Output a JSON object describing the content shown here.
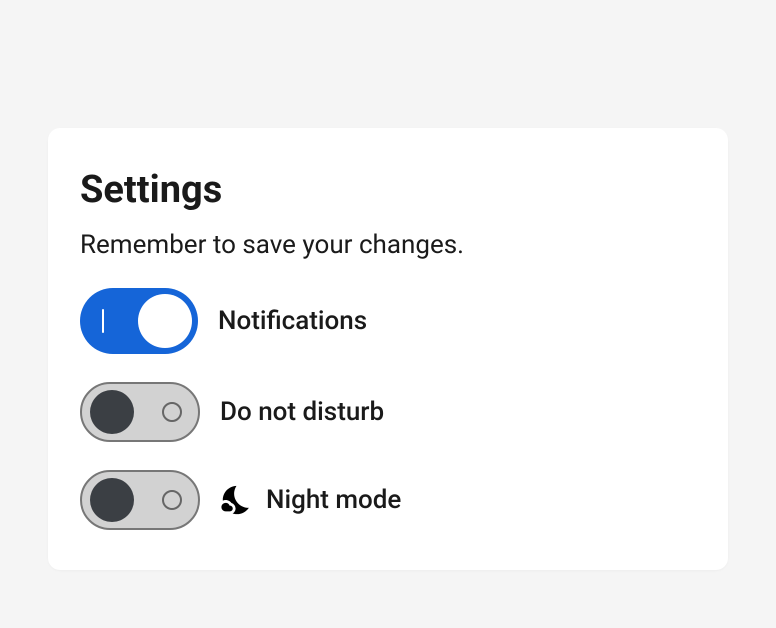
{
  "title": "Settings",
  "subtitle": "Remember to save your changes.",
  "switches": {
    "notifications": {
      "label": "Notifications",
      "checked": true
    },
    "doNotDisturb": {
      "label": "Do not disturb",
      "checked": false
    },
    "nightMode": {
      "label": "Night mode",
      "checked": false
    }
  }
}
